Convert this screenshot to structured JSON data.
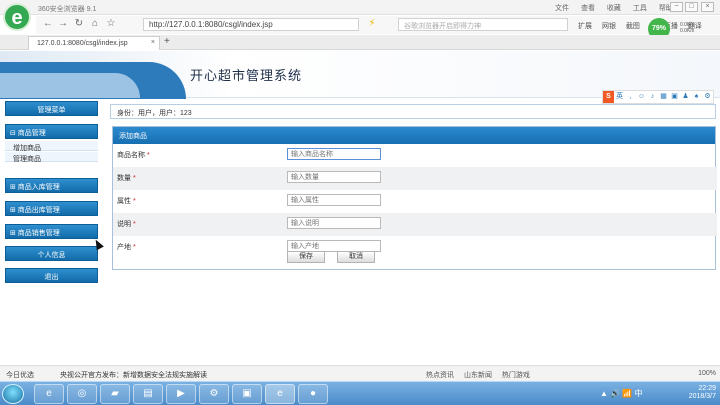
{
  "browser": {
    "title": "360安全浏览器 9.1",
    "logo": "e",
    "menus": [
      "文件",
      "查看",
      "收藏",
      "工具",
      "帮助"
    ],
    "url": "http://127.0.0.1:8080/csgl/index.jsp",
    "search_placeholder": "谷歌浏览器开启即得力神",
    "toolbar_items": [
      "扩展",
      "网银",
      "截图",
      "我的直播",
      "翻译"
    ],
    "performance": "79%",
    "speed_line1": "0.0K/s",
    "speed_line2": "0.0K/s",
    "tab_title": "127.0.0.1:8080/csgl/index.jsp",
    "tab_add": "+",
    "status_left": "今日优选",
    "status_news": "央视公开官方发布：新增数据安全法规实施解读",
    "status_items": [
      "热点资讯",
      "山东新闻",
      "热门游戏"
    ],
    "zoom": "100%",
    "accent": "#1f77b4"
  },
  "page": {
    "title": "开心超市管理系统",
    "breadcrumb": "身份：用户，用户：123"
  },
  "sidebar": {
    "system_menu": "管理菜单",
    "product_manage": "⊟ 商品管理",
    "sub_items": [
      "增加商品",
      "管理商品"
    ],
    "stock_in": "⊞ 商品入库管理",
    "stock_out": "⊞ 商品出库管理",
    "sales": "⊞ 商品销售管理",
    "personal_info": "个人信息",
    "logout": "退出"
  },
  "form": {
    "header": "添加商品",
    "fields": [
      {
        "label": "商品名称",
        "placeholder": "输入商品名称"
      },
      {
        "label": "数量",
        "placeholder": "输入数量"
      },
      {
        "label": "属性",
        "placeholder": "输入属性"
      },
      {
        "label": "说明",
        "placeholder": "输入说明"
      },
      {
        "label": "产地",
        "placeholder": "输入产地"
      }
    ],
    "required_mark": "*",
    "save": "保存",
    "cancel": "取消"
  },
  "taskbar": {
    "tray_text": "▲ 🔊 📶 中",
    "time": "22:29",
    "date": "2018/3/7"
  }
}
